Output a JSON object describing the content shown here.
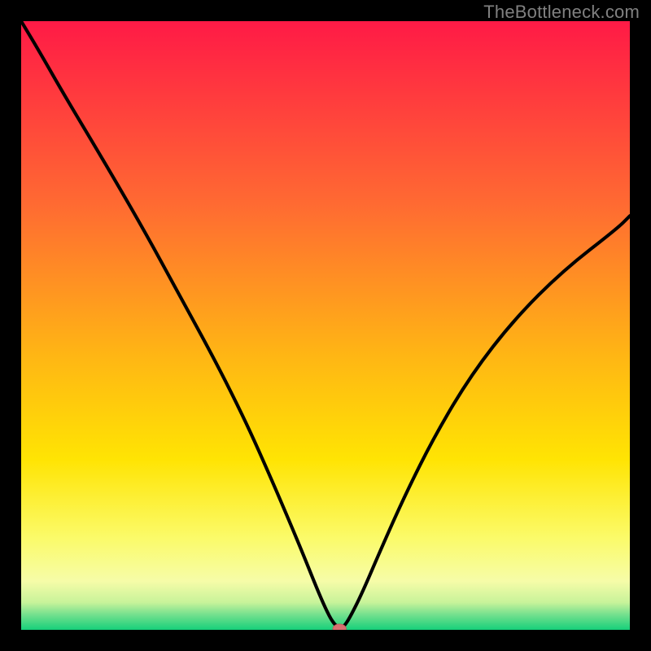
{
  "watermark": "TheBottleneck.com",
  "chart_data": {
    "type": "line",
    "title": "",
    "xlabel": "",
    "ylabel": "",
    "xlim": [
      0,
      100
    ],
    "ylim": [
      0,
      100
    ],
    "grid": false,
    "legend": false,
    "series": [
      {
        "name": "bottleneck-curve",
        "x": [
          0,
          3,
          7,
          13,
          20,
          26,
          32,
          37,
          41,
          44,
          46.5,
          48.5,
          50,
          51.2,
          52.3,
          53,
          54,
          56,
          59,
          63,
          68,
          74,
          81,
          89,
          98,
          100
        ],
        "y": [
          100,
          95,
          88,
          78,
          66,
          55,
          44,
          34,
          25,
          18,
          12,
          7,
          3.5,
          1.2,
          0.2,
          0.5,
          2,
          6,
          13,
          22,
          32,
          42,
          51,
          59,
          66,
          68
        ]
      }
    ],
    "marker": {
      "x": 52.3,
      "y": 0.2,
      "color": "#d77070"
    },
    "background": {
      "type": "vertical-gradient",
      "stops": [
        {
          "pos": 0.0,
          "color": "#ff1a46"
        },
        {
          "pos": 0.3,
          "color": "#ff6a32"
        },
        {
          "pos": 0.55,
          "color": "#ffb614"
        },
        {
          "pos": 0.72,
          "color": "#ffe403"
        },
        {
          "pos": 0.85,
          "color": "#fbfb6a"
        },
        {
          "pos": 0.92,
          "color": "#f6fca8"
        },
        {
          "pos": 0.955,
          "color": "#c8f39a"
        },
        {
          "pos": 0.975,
          "color": "#74e08e"
        },
        {
          "pos": 1.0,
          "color": "#17d07a"
        }
      ]
    }
  }
}
